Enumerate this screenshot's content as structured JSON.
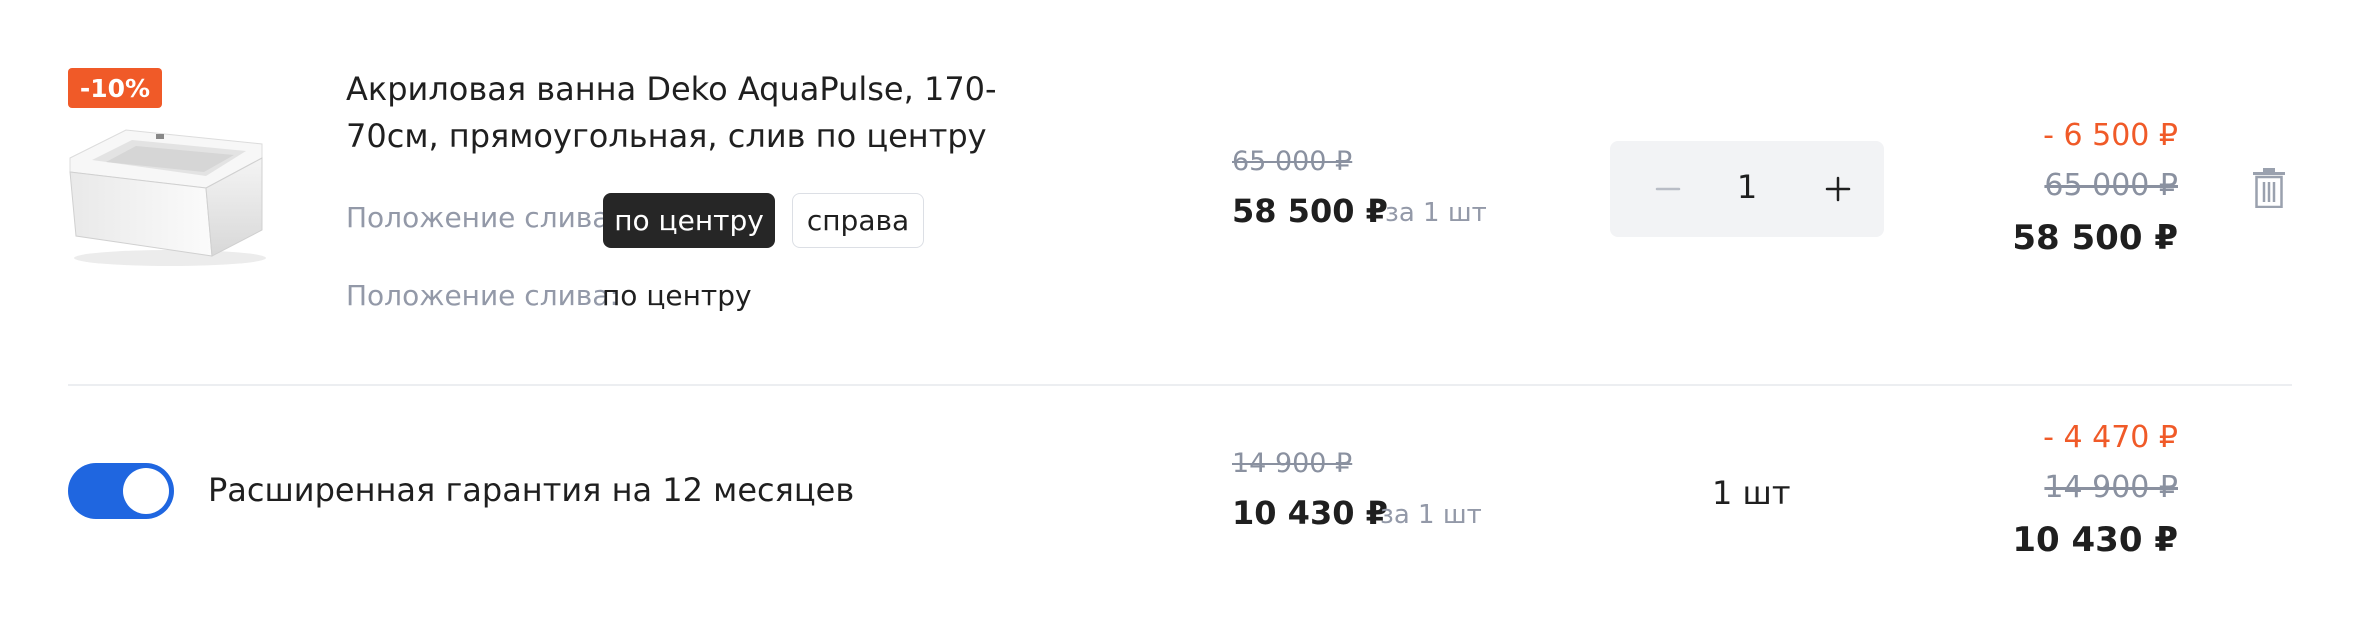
{
  "product": {
    "discount_badge": "-10%",
    "title": "Акриловая ванна Deko AquaPulse, 170-70см, прямоугольная, слив по центру",
    "drain_label": "Положение слива:",
    "drain_options": [
      "по центру",
      "справа"
    ],
    "drain_selected_index": 0,
    "drain_label_2": "Положение слива:",
    "drain_value": "по центру",
    "old_price": "65 000 ₽",
    "price": "58 500 ₽",
    "per_unit": "за 1 шт",
    "quantity": "1",
    "total_discount": "- 6 500 ₽",
    "total_old": "65 000 ₽",
    "total": "58 500 ₽"
  },
  "warranty": {
    "enabled": true,
    "title": "Расширенная гарантия на 12 месяцев",
    "old_price": "14 900 ₽",
    "price": "10 430 ₽",
    "per_unit": "за 1 шт",
    "quantity": "1 шт",
    "total_discount": "- 4 470 ₽",
    "total_old": "14 900 ₽",
    "total": "10 430 ₽"
  },
  "colors": {
    "accent_orange": "#f05a28",
    "toggle_blue": "#1f66e0",
    "selected_option_bg": "#262626",
    "muted_text": "#8a91a0"
  },
  "icons": {
    "minus": "minus-icon",
    "plus": "plus-icon",
    "delete": "trash-icon"
  }
}
